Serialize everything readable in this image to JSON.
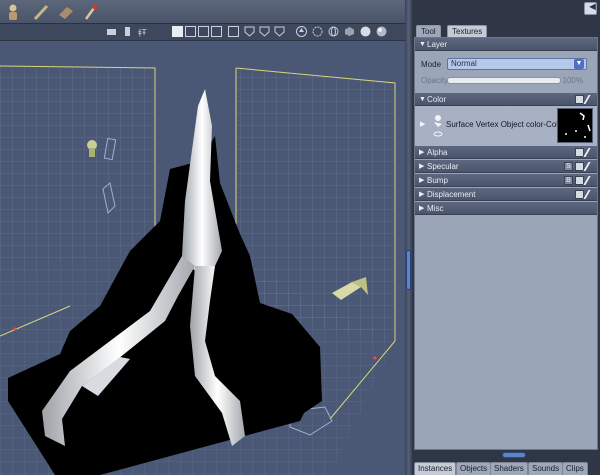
{
  "toolbar": {
    "tools": [
      {
        "icon": "figure-tool-icon"
      },
      {
        "icon": "wand-tool-icon"
      },
      {
        "icon": "block-tool-icon"
      },
      {
        "icon": "brush-tool-icon"
      }
    ]
  },
  "view_toolbar": {
    "icons": [
      "camera-tool-icon",
      "bottle-tool-icon",
      "antenna-tool-icon",
      "single-view-icon",
      "two-view-icon",
      "three-view-icon",
      "four-view-icon",
      "shield-view-icon",
      "shield2-view-icon",
      "shield3-view-icon",
      "arrow-up-icon",
      "target-icon",
      "globe-icon",
      "cube-icon",
      "sphere-icon",
      "smooth-sphere-icon"
    ]
  },
  "panel": {
    "collapse_label": "◄",
    "tabs": [
      "Tool",
      "Textures"
    ],
    "active_tab": "Textures",
    "layer": {
      "title": "Layer",
      "mode_label": "Mode",
      "mode_value": "Normal",
      "opacity_label": "Opacity",
      "opacity_value": "100%",
      "opacity_fraction": 1.0
    },
    "sections": [
      {
        "title": "Color",
        "icons": [
          "folder",
          "brush"
        ]
      },
      {
        "title": "Alpha",
        "icons": [
          "folder",
          "brush"
        ]
      },
      {
        "title": "Specular",
        "icons": [
          "S",
          "folder",
          "brush"
        ]
      },
      {
        "title": "Bump",
        "icons": [
          "B",
          "folder",
          "brush"
        ]
      },
      {
        "title": "Displacement",
        "icons": [
          "folder",
          "brush"
        ]
      },
      {
        "title": "Misc",
        "icons": []
      }
    ],
    "color_row": {
      "label": "Surface Vertex Object color-Color",
      "icon": "vertex-color-icon"
    }
  },
  "bottom_tabs": [
    "Instances",
    "Objects",
    "Shaders",
    "Sounds",
    "Clips"
  ],
  "active_bottom_tab": "Instances",
  "colors": {
    "viewport_bg": "#4a5876",
    "grid_line": "#7f8fae",
    "room_edge": "#d9d57a",
    "mesh": "#000000",
    "panel_bg": "#9aa5b8",
    "accent": "#5f84c8"
  }
}
